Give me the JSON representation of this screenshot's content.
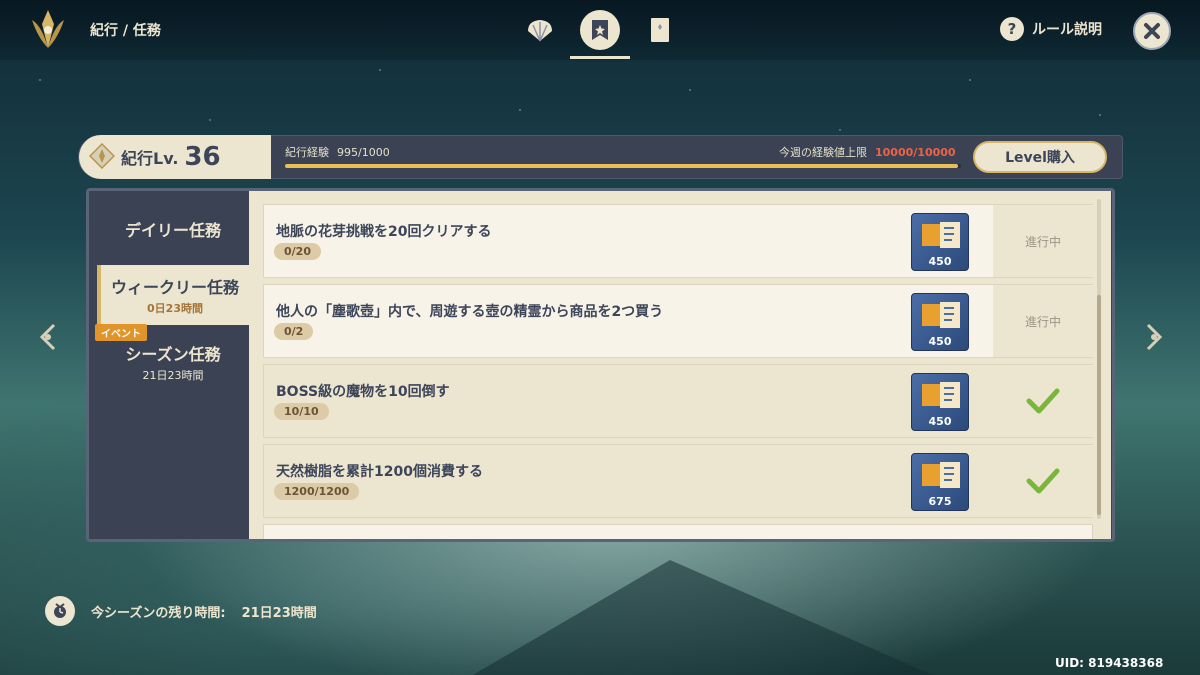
{
  "header": {
    "breadcrumb": "紀行 / 任務",
    "tabs": [
      {
        "icon": "shell-icon"
      },
      {
        "icon": "banner-icon",
        "active": true
      },
      {
        "icon": "page-icon"
      }
    ],
    "help_label": "ルール説明"
  },
  "level_bar": {
    "level_label": "紀行Lv.",
    "level": "36",
    "exp_label": "紀行経験",
    "exp_value": "995/1000",
    "exp_fraction": 0.995,
    "weekly_cap_label": "今週の経験値上限",
    "weekly_cap_value": "10000/10000",
    "buy_button": "Level購入"
  },
  "sidebar": {
    "tabs": [
      {
        "label": "デイリー任務",
        "sub": ""
      },
      {
        "label": "ウィークリー任務",
        "sub": "0日23時間",
        "active": true
      },
      {
        "label": "シーズン任務",
        "sub": "21日23時間"
      }
    ],
    "event_tag": "イベント"
  },
  "quests": [
    {
      "title": "地脈の花芽挑戦を20回クリアする",
      "progress": "0/20",
      "reward": "450",
      "status": "進行中"
    },
    {
      "title": "他人の「塵歌壺」内で、周遊する壺の精霊から商品を2つ買う",
      "progress": "0/2",
      "reward": "450",
      "status": "進行中"
    },
    {
      "title": "BOSS級の魔物を10回倒す",
      "progress": "10/10",
      "reward": "450",
      "status": "check"
    },
    {
      "title": "天然樹脂を累計1200個消費する",
      "progress": "1200/1200",
      "reward": "675",
      "status": "check"
    }
  ],
  "footer": {
    "season_label": "今シーズンの残り時間:",
    "season_value": "21日23時間",
    "uid": "UID: 819438368"
  },
  "colors": {
    "accent_gold": "#e9bf54",
    "cream": "#ece5cf",
    "panel_dark": "#3a4254",
    "cap_red": "#f06245",
    "check_green": "#7ab63a"
  }
}
